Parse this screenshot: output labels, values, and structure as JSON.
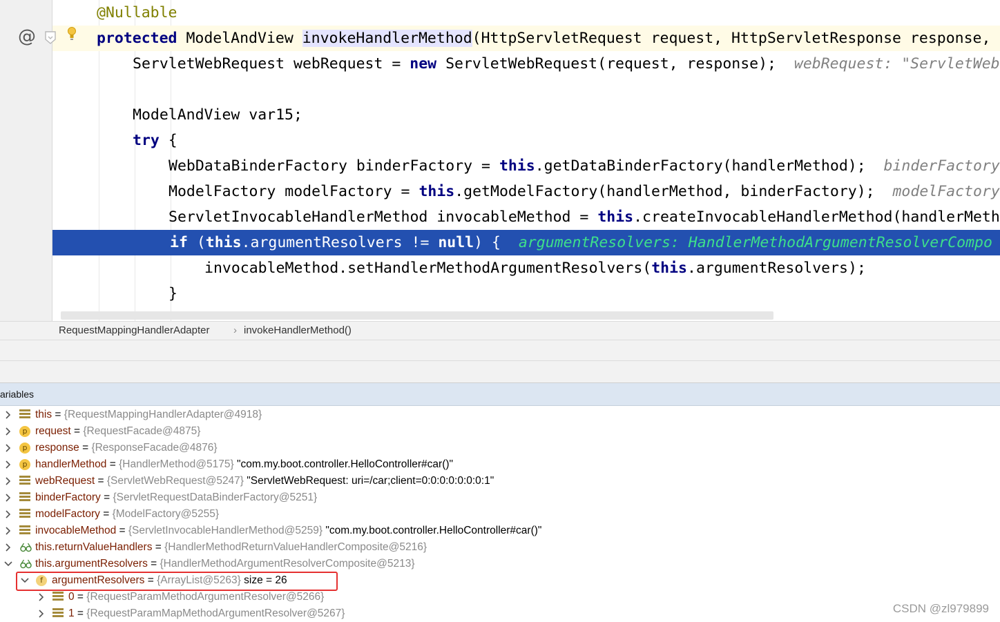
{
  "editor": {
    "gutter_at_symbol": "@",
    "lines": [
      {
        "id": "annotation",
        "parts": [
          {
            "t": "@Nullable",
            "c": "ann"
          }
        ]
      },
      {
        "id": "signature",
        "parts": [
          {
            "t": "protected",
            "c": "kw"
          },
          {
            "t": " ModelAndView ",
            "c": ""
          },
          {
            "t": "invokeHandlerMethod",
            "c": "sel"
          },
          {
            "t": "(HttpServletRequest request, HttpServletResponse response,",
            "c": ""
          }
        ]
      },
      {
        "id": "webrequest",
        "parts": [
          {
            "t": "ServletWebRequest webRequest = ",
            "c": ""
          },
          {
            "t": "new",
            "c": "kw"
          },
          {
            "t": " ServletWebRequest(request, response);  ",
            "c": ""
          },
          {
            "t": "webRequest: \"ServletWeb",
            "c": "hint"
          }
        ]
      },
      {
        "id": "blank1",
        "parts": [
          {
            "t": "",
            "c": ""
          }
        ]
      },
      {
        "id": "var15",
        "parts": [
          {
            "t": "ModelAndView var15;",
            "c": ""
          }
        ]
      },
      {
        "id": "try",
        "parts": [
          {
            "t": "try",
            "c": "kw"
          },
          {
            "t": " {",
            "c": ""
          }
        ]
      },
      {
        "id": "binder",
        "parts": [
          {
            "t": "WebDataBinderFactory binderFactory = ",
            "c": ""
          },
          {
            "t": "this",
            "c": "kw"
          },
          {
            "t": ".getDataBinderFactory(handlerMethod);  ",
            "c": ""
          },
          {
            "t": "binderFactory",
            "c": "hint"
          }
        ]
      },
      {
        "id": "model",
        "parts": [
          {
            "t": "ModelFactory modelFactory = ",
            "c": ""
          },
          {
            "t": "this",
            "c": "kw"
          },
          {
            "t": ".getModelFactory(handlerMethod, binderFactory);  ",
            "c": ""
          },
          {
            "t": "modelFactory",
            "c": "hint"
          }
        ]
      },
      {
        "id": "invocable",
        "parts": [
          {
            "t": "ServletInvocableHandlerMethod invocableMethod = ",
            "c": ""
          },
          {
            "t": "this",
            "c": "kw"
          },
          {
            "t": ".createInvocableHandlerMethod(handlerMeth",
            "c": ""
          }
        ]
      },
      {
        "id": "if",
        "parts": [
          {
            "t": "if",
            "c": "kw"
          },
          {
            "t": " (",
            "c": ""
          },
          {
            "t": "this",
            "c": "kw"
          },
          {
            "t": ".argumentResolvers != ",
            "c": ""
          },
          {
            "t": "null",
            "c": "kw"
          },
          {
            "t": ") {  ",
            "c": ""
          },
          {
            "t": "argumentResolvers: HandlerMethodArgumentResolverCompo",
            "c": "hint"
          }
        ]
      },
      {
        "id": "setresolvers",
        "parts": [
          {
            "t": "invocableMethod.setHandlerMethodArgumentResolvers(",
            "c": ""
          },
          {
            "t": "this",
            "c": "kw"
          },
          {
            "t": ".argumentResolvers);",
            "c": ""
          }
        ]
      },
      {
        "id": "closebrace",
        "parts": [
          {
            "t": "}",
            "c": ""
          }
        ]
      }
    ]
  },
  "breadcrumb": {
    "class_name": "RequestMappingHandlerAdapter",
    "separator": "›",
    "method_name": "invokeHandlerMethod()"
  },
  "variables": {
    "header": "ariables",
    "rows": [
      {
        "icon": "field",
        "arrow": "right",
        "name": "this",
        "eq": " = ",
        "value": "{RequestMappingHandlerAdapter@4918}",
        "str": ""
      },
      {
        "icon": "param",
        "arrow": "right",
        "name": "request",
        "eq": " = ",
        "value": "{RequestFacade@4875}",
        "str": ""
      },
      {
        "icon": "param",
        "arrow": "right",
        "name": "response",
        "eq": " = ",
        "value": "{ResponseFacade@4876}",
        "str": ""
      },
      {
        "icon": "param",
        "arrow": "right",
        "name": "handlerMethod",
        "eq": " = ",
        "value": "{HandlerMethod@5175}",
        "str": " \"com.my.boot.controller.HelloController#car()\""
      },
      {
        "icon": "field",
        "arrow": "right",
        "name": "webRequest",
        "eq": " = ",
        "value": "{ServletWebRequest@5247}",
        "str": " \"ServletWebRequest: uri=/car;client=0:0:0:0:0:0:0:1\""
      },
      {
        "icon": "field",
        "arrow": "right",
        "name": "binderFactory",
        "eq": " = ",
        "value": "{ServletRequestDataBinderFactory@5251}",
        "str": ""
      },
      {
        "icon": "field",
        "arrow": "right",
        "name": "modelFactory",
        "eq": " = ",
        "value": "{ModelFactory@5255}",
        "str": ""
      },
      {
        "icon": "field",
        "arrow": "right",
        "name": "invocableMethod",
        "eq": " = ",
        "value": "{ServletInvocableHandlerMethod@5259}",
        "str": " \"com.my.boot.controller.HelloController#car()\""
      },
      {
        "icon": "watch",
        "arrow": "right",
        "name": "this.returnValueHandlers",
        "eq": " = ",
        "value": "{HandlerMethodReturnValueHandlerComposite@5216}",
        "str": ""
      },
      {
        "icon": "watch",
        "arrow": "down",
        "name": "this.argumentResolvers",
        "eq": " = ",
        "value": "{HandlerMethodArgumentResolverComposite@5213}",
        "str": ""
      },
      {
        "icon": "final-field",
        "arrow": "down",
        "name": "argumentResolvers",
        "eq": " = ",
        "value": "{ArrayList@5263}",
        "str": "  size = 26",
        "icon_letter": "f"
      },
      {
        "icon": "field",
        "arrow": "right",
        "name": "0",
        "eq": " = ",
        "value": "{RequestParamMethodArgumentResolver@5266}",
        "str": ""
      },
      {
        "icon": "field",
        "arrow": "right",
        "name": "1",
        "eq": " = ",
        "value": "{RequestParamMapMethodArgumentResolver@5267}",
        "str": ""
      }
    ],
    "param_icon_letter": "p"
  },
  "watermark": "CSDN @zl979899",
  "colors": {
    "exec_line": "#2350b0",
    "highlight_box": "#e53030",
    "keyword": "#000080",
    "annotation": "#808000",
    "var_name": "#7a1e00",
    "hint_on_exec": "#3ee08a"
  }
}
